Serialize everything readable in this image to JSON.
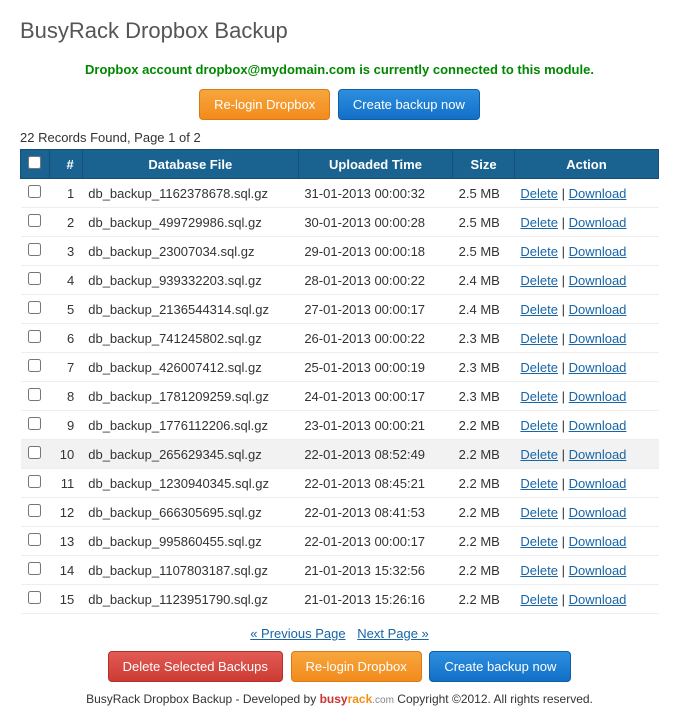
{
  "title": "BusyRack Dropbox Backup",
  "status": "Dropbox account dropbox@mydomain.com is currently connected to this module.",
  "buttons": {
    "relogin": "Re-login Dropbox",
    "create": "Create backup now",
    "delete_selected": "Delete Selected Backups"
  },
  "records_info": "22 Records Found, Page 1 of 2",
  "headers": {
    "num": "#",
    "file": "Database File",
    "time": "Uploaded Time",
    "size": "Size",
    "action": "Action"
  },
  "action_labels": {
    "delete": "Delete",
    "download": "Download",
    "sep": " | "
  },
  "rows": [
    {
      "n": "1",
      "file": "db_backup_1162378678.sql.gz",
      "time": "31-01-2013 00:00:32",
      "size": "2.5 MB"
    },
    {
      "n": "2",
      "file": "db_backup_499729986.sql.gz",
      "time": "30-01-2013 00:00:28",
      "size": "2.5 MB"
    },
    {
      "n": "3",
      "file": "db_backup_23007034.sql.gz",
      "time": "29-01-2013 00:00:18",
      "size": "2.5 MB"
    },
    {
      "n": "4",
      "file": "db_backup_939332203.sql.gz",
      "time": "28-01-2013 00:00:22",
      "size": "2.4 MB"
    },
    {
      "n": "5",
      "file": "db_backup_2136544314.sql.gz",
      "time": "27-01-2013 00:00:17",
      "size": "2.4 MB"
    },
    {
      "n": "6",
      "file": "db_backup_741245802.sql.gz",
      "time": "26-01-2013 00:00:22",
      "size": "2.3 MB"
    },
    {
      "n": "7",
      "file": "db_backup_426007412.sql.gz",
      "time": "25-01-2013 00:00:19",
      "size": "2.3 MB"
    },
    {
      "n": "8",
      "file": "db_backup_1781209259.sql.gz",
      "time": "24-01-2013 00:00:17",
      "size": "2.3 MB"
    },
    {
      "n": "9",
      "file": "db_backup_1776112206.sql.gz",
      "time": "23-01-2013 00:00:21",
      "size": "2.2 MB"
    },
    {
      "n": "10",
      "file": "db_backup_265629345.sql.gz",
      "time": "22-01-2013 08:52:49",
      "size": "2.2 MB",
      "hl": true
    },
    {
      "n": "11",
      "file": "db_backup_1230940345.sql.gz",
      "time": "22-01-2013 08:45:21",
      "size": "2.2 MB"
    },
    {
      "n": "12",
      "file": "db_backup_666305695.sql.gz",
      "time": "22-01-2013 08:41:53",
      "size": "2.2 MB"
    },
    {
      "n": "13",
      "file": "db_backup_995860455.sql.gz",
      "time": "22-01-2013 00:00:17",
      "size": "2.2 MB"
    },
    {
      "n": "14",
      "file": "db_backup_1107803187.sql.gz",
      "time": "21-01-2013 15:32:56",
      "size": "2.2 MB"
    },
    {
      "n": "15",
      "file": "db_backup_1123951790.sql.gz",
      "time": "21-01-2013 15:26:16",
      "size": "2.2 MB"
    }
  ],
  "pagination": {
    "prev": "« Previous Page",
    "next": "Next Page »"
  },
  "footer": {
    "pre": "BusyRack Dropbox Backup - Developed by ",
    "brand_busy": "busy",
    "brand_rack": "rack",
    "brand_com": ".com",
    "post": " Copyright ©2012. All rights reserved."
  }
}
